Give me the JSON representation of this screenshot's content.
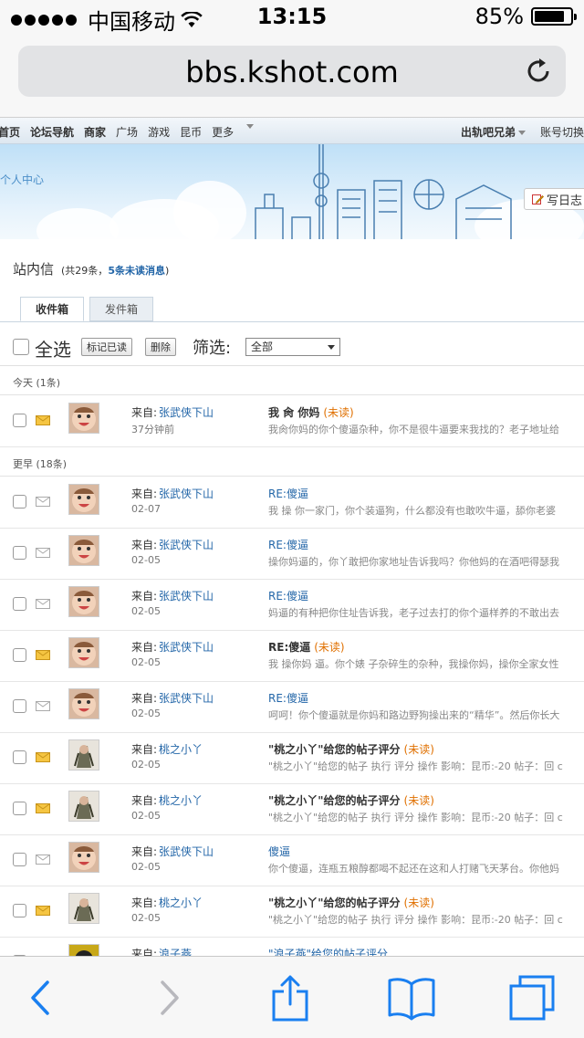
{
  "status_bar": {
    "carrier": "中国移动",
    "time": "13:15",
    "battery": "85%",
    "battery_level": 0.85
  },
  "browser": {
    "url": "bbs.kshot.com"
  },
  "site_nav": {
    "items": [
      {
        "label": "首页",
        "bold": true
      },
      {
        "label": "论坛导航",
        "bold": true
      },
      {
        "label": "商家",
        "bold": true
      },
      {
        "label": "广场",
        "bold": false
      },
      {
        "label": "游戏",
        "bold": false
      },
      {
        "label": "昆币",
        "bold": false
      },
      {
        "label": "更多",
        "bold": false
      }
    ],
    "user": "出轨吧兄弟",
    "account": "账号切换"
  },
  "banner": {
    "user_center": "个人中心",
    "write_diary": "写日志"
  },
  "inbox": {
    "title": "站内信",
    "count_prefix": "(共29条，",
    "unread_count": "5条未读消息",
    "count_suffix": ")",
    "tabs": {
      "inbox": "收件箱",
      "outbox": "发件箱"
    },
    "select_all": "全选",
    "mark_read": "标记已读",
    "delete": "删除",
    "filter_label": "筛选:",
    "filter_value": "全部"
  },
  "groups": {
    "today": "今天 (1条)",
    "earlier": "更早 (18条)"
  },
  "from_label": "来自:",
  "unread_label": "(未读)",
  "messages": [
    {
      "sender": "张武侠下山",
      "date": "37分钟前",
      "subject": "我 肏 你妈",
      "unread": true,
      "snippet": "我肏你妈的你个傻逼杂种，你不是很牛逼要来我找的？老子地址给",
      "avatar": "baby"
    },
    {
      "sender": "张武侠下山",
      "date": "02-07",
      "subject": "RE:傻逼",
      "unread": false,
      "snippet": "我 操 你一家门，你个装逼狗，什么都没有也敢吹牛逼，舔你老婆",
      "avatar": "baby"
    },
    {
      "sender": "张武侠下山",
      "date": "02-05",
      "subject": "RE:傻逼",
      "unread": false,
      "snippet": "操你妈逼的，你丫敢把你家地址告诉我吗？你他妈的在酒吧得瑟我",
      "avatar": "baby"
    },
    {
      "sender": "张武侠下山",
      "date": "02-05",
      "subject": "RE:傻逼",
      "unread": false,
      "snippet": "妈逼的有种把你住址告诉我，老子过去打的你个逼样养的不敢出去",
      "avatar": "baby"
    },
    {
      "sender": "张武侠下山",
      "date": "02-05",
      "subject": "RE:傻逼",
      "unread": true,
      "snippet": "我 操你妈 逼。你个婊 子杂碎生的杂种，我操你妈，操你全家女性",
      "avatar": "baby"
    },
    {
      "sender": "张武侠下山",
      "date": "02-05",
      "subject": "RE:傻逼",
      "unread": false,
      "snippet": "呵呵！你个傻逼就是你妈和路边野狗操出来的“精华”。然后你长大",
      "avatar": "baby"
    },
    {
      "sender": "桃之小丫",
      "date": "02-05",
      "subject": "\"桃之小丫\"给您的帖子评分",
      "unread": true,
      "snippet": "\"桃之小丫\"给您的帖子 执行 评分 操作 影响：昆币:-20 帖子：回 c",
      "avatar": "girl"
    },
    {
      "sender": "桃之小丫",
      "date": "02-05",
      "subject": "\"桃之小丫\"给您的帖子评分",
      "unread": true,
      "snippet": "\"桃之小丫\"给您的帖子 执行 评分 操作 影响：昆币:-20 帖子：回 c",
      "avatar": "girl"
    },
    {
      "sender": "张武侠下山",
      "date": "02-05",
      "subject": "傻逼",
      "unread": false,
      "snippet": "你个傻逼，连瓶五粮醇都喝不起还在这和人打赌飞天茅台。你他妈",
      "avatar": "baby"
    },
    {
      "sender": "桃之小丫",
      "date": "02-05",
      "subject": "\"桃之小丫\"给您的帖子评分",
      "unread": true,
      "snippet": "\"桃之小丫\"给您的帖子 执行 评分 操作 影响：昆币:-20 帖子：回 c",
      "avatar": "girl"
    },
    {
      "sender": "浪子燕",
      "date": "",
      "subject": "\"浪子燕\"给您的帖子评分",
      "unread": false,
      "snippet": "",
      "avatar": "other"
    }
  ]
}
